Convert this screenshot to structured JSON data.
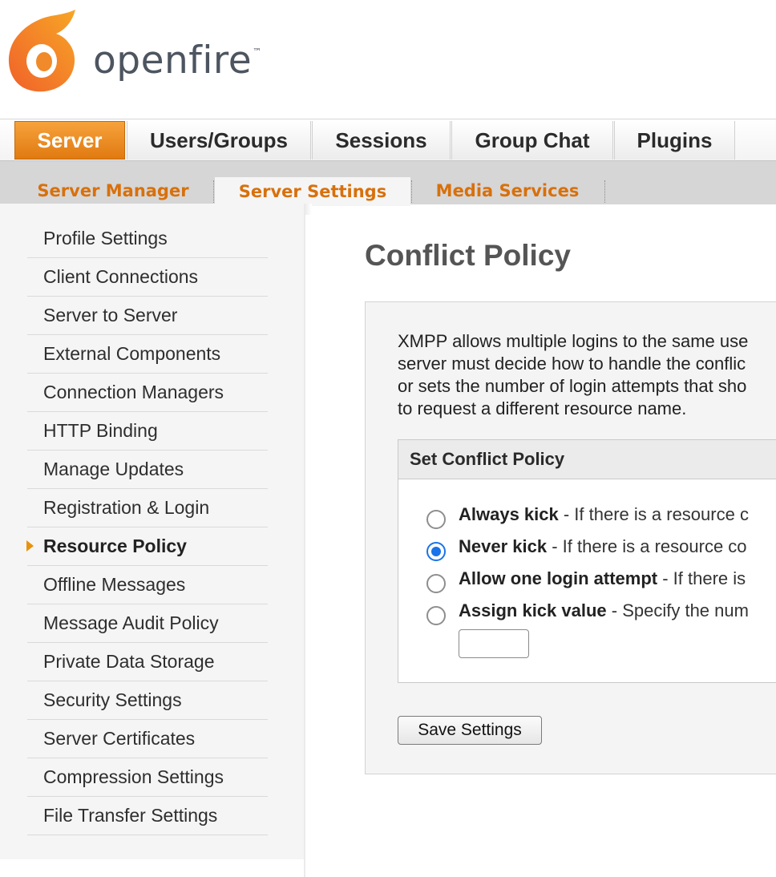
{
  "brand": {
    "name": "openfire",
    "trademark": "™"
  },
  "main_tabs": [
    {
      "label": "Server",
      "active": true
    },
    {
      "label": "Users/Groups"
    },
    {
      "label": "Sessions"
    },
    {
      "label": "Group Chat"
    },
    {
      "label": "Plugins"
    }
  ],
  "sub_tabs": [
    {
      "label": "Server Manager"
    },
    {
      "label": "Server Settings",
      "active": true
    },
    {
      "label": "Media Services"
    }
  ],
  "sidebar": {
    "items": [
      {
        "label": "Profile Settings"
      },
      {
        "label": "Client Connections"
      },
      {
        "label": "Server to Server"
      },
      {
        "label": "External Components"
      },
      {
        "label": "Connection Managers"
      },
      {
        "label": "HTTP Binding"
      },
      {
        "label": "Manage Updates"
      },
      {
        "label": "Registration & Login"
      },
      {
        "label": "Resource Policy",
        "active": true
      },
      {
        "label": "Offline Messages"
      },
      {
        "label": "Message Audit Policy"
      },
      {
        "label": "Private Data Storage"
      },
      {
        "label": "Security Settings"
      },
      {
        "label": "Server Certificates"
      },
      {
        "label": "Compression Settings"
      },
      {
        "label": "File Transfer Settings"
      }
    ]
  },
  "main": {
    "title": "Conflict Policy",
    "description_lines": [
      "XMPP allows multiple logins to the same use",
      "server must decide how to handle the conflic",
      "or sets the number of login attempts that sho",
      "to request a different resource name."
    ],
    "box_title": "Set Conflict Policy",
    "options": [
      {
        "bold": "Always kick",
        "text": " - If there is a resource c",
        "checked": false
      },
      {
        "bold": "Never kick",
        "text": " - If there is a resource co",
        "checked": true
      },
      {
        "bold": "Allow one login attempt",
        "text": " - If there is",
        "checked": false
      },
      {
        "bold": "Assign kick value",
        "text": " - Specify the num",
        "checked": false
      }
    ],
    "kick_value": "",
    "save_label": "Save Settings"
  },
  "colors": {
    "accent": "#e8860f",
    "link_orange": "#d8700c",
    "radio_blue": "#1a73e8"
  }
}
